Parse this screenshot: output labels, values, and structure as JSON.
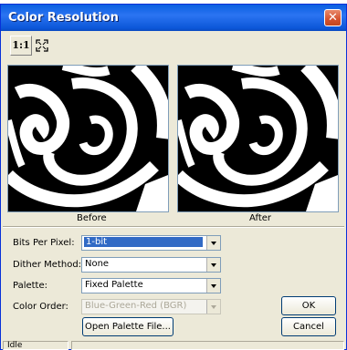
{
  "window": {
    "title": "Color Resolution",
    "close_glyph": "✕"
  },
  "toolbar": {
    "zoom_1to1": "1:1",
    "zoom_fit_icon": "fit-to-window-icon"
  },
  "preview": {
    "before_label": "Before",
    "after_label": "After"
  },
  "settings": {
    "bits_per_pixel": {
      "label": "Bits Per Pixel:",
      "value": "1-bit"
    },
    "dither_method": {
      "label": "Dither Method:",
      "value": "None"
    },
    "palette": {
      "label": "Palette:",
      "value": "Fixed Palette"
    },
    "color_order": {
      "label": "Color Order:",
      "value": "Blue-Green-Red (BGR)"
    }
  },
  "buttons": {
    "open_palette": "Open Palette File...",
    "ok": "OK",
    "cancel": "Cancel"
  },
  "status": {
    "text": "Idle"
  },
  "colors": {
    "titlebar": "#0b5ce0",
    "selection": "#316ac5",
    "face": "#ece9d8"
  }
}
